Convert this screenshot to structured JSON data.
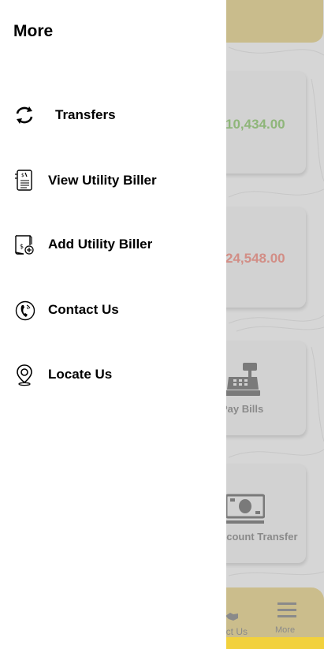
{
  "drawer": {
    "title": "More",
    "items": [
      {
        "label": "Transfers",
        "icon": "refresh-icon"
      },
      {
        "label": "View Utility Biller",
        "icon": "bill-document-icon"
      },
      {
        "label": "Add Utility Biller",
        "icon": "add-bill-icon"
      },
      {
        "label": "Contact Us",
        "icon": "phone-icon"
      },
      {
        "label": "Locate Us",
        "icon": "location-pin-icon"
      }
    ]
  },
  "background": {
    "cards": [
      {
        "amount": "10,434.00",
        "color": "#8fb67a"
      },
      {
        "amount": "24,548.00",
        "color": "#d28e86"
      },
      {
        "label": "Pay Bills",
        "icon": "cash-register-icon"
      },
      {
        "label": "ccount Transfer",
        "icon": "cash-icon"
      }
    ],
    "bottom_nav": {
      "contact_label": "act Us",
      "more_label": "More"
    }
  },
  "colors": {
    "header": "#c9bc8c",
    "bottom_bar": "#f2d13c"
  }
}
